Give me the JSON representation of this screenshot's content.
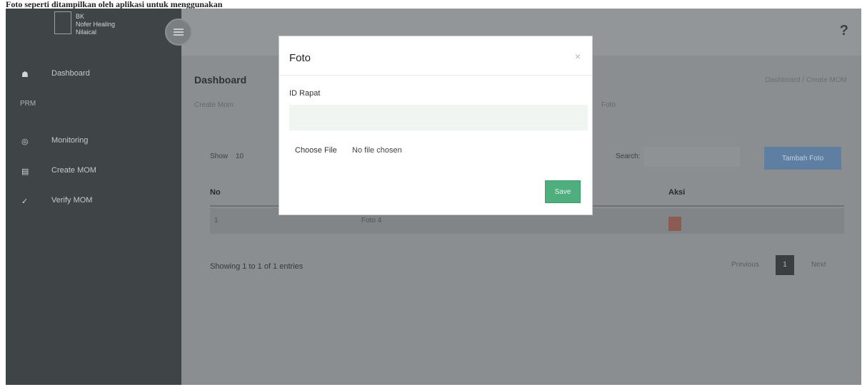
{
  "caption": "Foto seperti ditampilkan oleh aplikasi untuk menggunakan",
  "sidebar": {
    "brand_line1": "BK",
    "brand_line2": "Nofer Healing",
    "brand_line3": "Nilaical",
    "section": "PRM",
    "items": [
      {
        "label": "Dashboard",
        "icon": "home-icon"
      },
      {
        "label": "Monitoring",
        "icon": "monitor-icon"
      },
      {
        "label": "Create MOM",
        "icon": "document-icon"
      },
      {
        "label": "Verify MOM",
        "icon": "check-icon"
      }
    ]
  },
  "header": {
    "page_title": "Dashboard",
    "breadcrumb": "Dashboard  /  Create MOM",
    "tabs": [
      "Create Mom",
      "Foto"
    ]
  },
  "table": {
    "show_label": "Show",
    "show_value": "10",
    "search_label": "Search:",
    "add_button": "Tambah Foto",
    "columns": [
      "No",
      "Aksi"
    ],
    "rows": [
      {
        "no": "1",
        "name": "Foto 4"
      }
    ],
    "info": "Showing 1 to 1 of 1 entries",
    "prev": "Previous",
    "page": "1",
    "next": "Next"
  },
  "modal": {
    "title": "Foto",
    "close": "×",
    "field_label": "ID Rapat",
    "file_button": "Choose File",
    "file_status": "No file chosen",
    "save": "Save"
  },
  "colors": {
    "sidebar_bg": "#3f4447",
    "save_green": "#4fae7e",
    "add_blue": "#5e7fa2"
  }
}
